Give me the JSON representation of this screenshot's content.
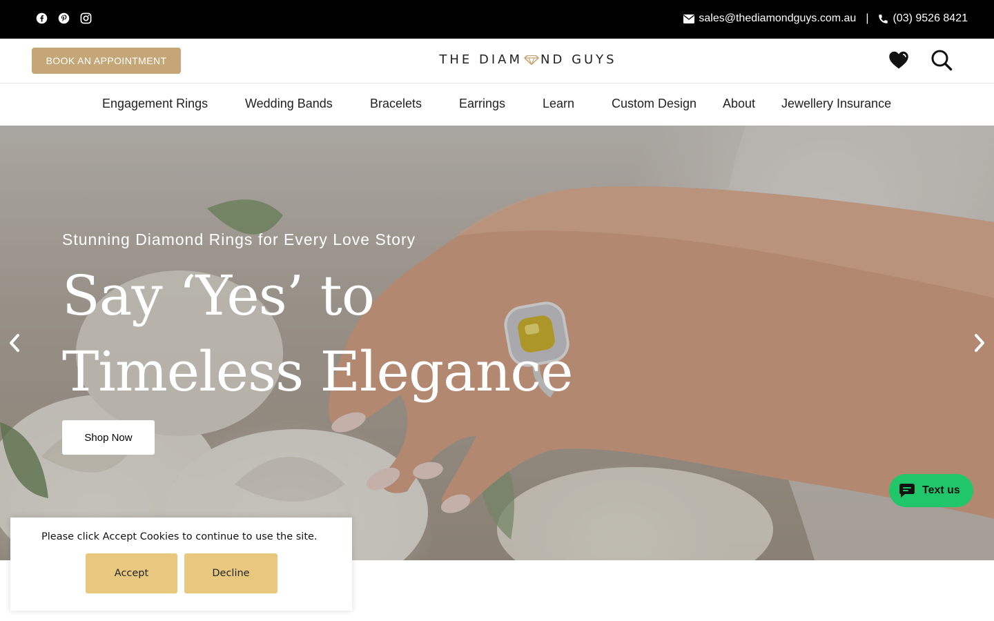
{
  "topbar": {
    "social_icons": [
      "facebook-icon",
      "pinterest-icon",
      "instagram-icon"
    ],
    "email": "sales@thediamondguys.com.au",
    "separator": "|",
    "phone": "(03) 9526 8421"
  },
  "header": {
    "book_label": "BOOK AN APPOINTMENT",
    "logo_left": "THE DIAM",
    "logo_right": "ND GUYS",
    "icons": [
      "heart-icon",
      "search-icon"
    ]
  },
  "nav": {
    "items": [
      {
        "label": "Engagement Rings"
      },
      {
        "label": "Wedding Bands"
      },
      {
        "label": "Bracelets"
      },
      {
        "label": "Earrings"
      },
      {
        "label": "Learn"
      },
      {
        "label": "Custom Design"
      },
      {
        "label": "About"
      },
      {
        "label": "Jewellery Insurance"
      }
    ]
  },
  "hero": {
    "subtitle": "Stunning Diamond Rings for Every Love Story",
    "title_line1": "Say ‘Yes’ to",
    "title_line2": "Timeless Elegance",
    "cta": "Shop Now"
  },
  "chat": {
    "label": "Text us"
  },
  "cookie": {
    "message": "Please click Accept Cookies to continue to use the site.",
    "accept": "Accept",
    "decline": "Decline"
  },
  "colors": {
    "accent_gold": "#c5a676",
    "cookie_gold": "#e8c87f",
    "chat_green": "#21c66b"
  }
}
